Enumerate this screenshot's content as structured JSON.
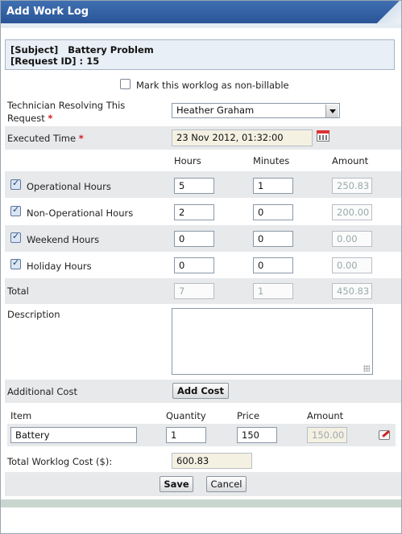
{
  "window": {
    "title": "Add Work Log"
  },
  "subject": {
    "subject_label": "[Subject]",
    "subject_value": "Battery Problem",
    "request_label": "[Request ID] :",
    "request_value": "15"
  },
  "non_billable": {
    "label": "Mark this worklog as non-billable",
    "checked": false
  },
  "technician": {
    "label_line1": "Technician Resolving This",
    "label_line2": "Request",
    "required": "*",
    "value": "Heather Graham"
  },
  "executed_time": {
    "label": "Executed Time",
    "required": "*",
    "value": "23 Nov 2012, 01:32:00",
    "icon": "calendar-icon"
  },
  "hours_table": {
    "headers": {
      "hours": "Hours",
      "minutes": "Minutes",
      "amount": "Amount"
    },
    "rows": [
      {
        "label": "Operational Hours",
        "checked": true,
        "hours": "5",
        "minutes": "1",
        "amount": "250.83"
      },
      {
        "label": "Non-Operational Hours",
        "checked": true,
        "hours": "2",
        "minutes": "0",
        "amount": "200.00"
      },
      {
        "label": "Weekend Hours",
        "checked": true,
        "hours": "0",
        "minutes": "0",
        "amount": "0.00"
      },
      {
        "label": "Holiday Hours",
        "checked": true,
        "hours": "0",
        "minutes": "0",
        "amount": "0.00"
      }
    ],
    "total": {
      "label": "Total",
      "hours": "7",
      "minutes": "1",
      "amount": "450.83"
    }
  },
  "description": {
    "label": "Description",
    "value": ""
  },
  "additional_cost": {
    "label": "Additional Cost",
    "add_button": "Add Cost",
    "headers": {
      "item": "Item",
      "quantity": "Quantity",
      "price": "Price",
      "amount": "Amount"
    },
    "rows": [
      {
        "item": "Battery",
        "quantity": "1",
        "price": "150",
        "amount": "150.00",
        "delete_icon": "delete-icon"
      }
    ]
  },
  "total_cost": {
    "label": "Total Worklog Cost ($):",
    "value": "600.83"
  },
  "actions": {
    "save": "Save",
    "cancel": "Cancel"
  }
}
